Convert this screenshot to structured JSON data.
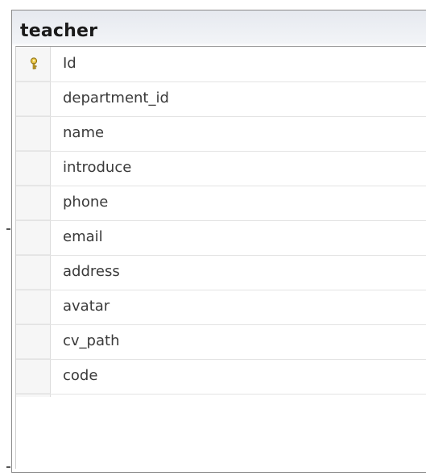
{
  "table": {
    "title": "teacher",
    "columns": [
      {
        "name": "Id",
        "primary_key": true,
        "icon": "primary-key-icon"
      },
      {
        "name": "department_id",
        "primary_key": false
      },
      {
        "name": "name",
        "primary_key": false
      },
      {
        "name": "introduce",
        "primary_key": false
      },
      {
        "name": "phone",
        "primary_key": false
      },
      {
        "name": "email",
        "primary_key": false
      },
      {
        "name": "address",
        "primary_key": false
      },
      {
        "name": "avatar",
        "primary_key": false
      },
      {
        "name": "cv_path",
        "primary_key": false
      },
      {
        "name": "code",
        "primary_key": false
      }
    ]
  },
  "colors": {
    "border": "#8a8a8a",
    "key": "#c9a227",
    "text": "#3a3a3a",
    "title": "#1a1a1a"
  }
}
